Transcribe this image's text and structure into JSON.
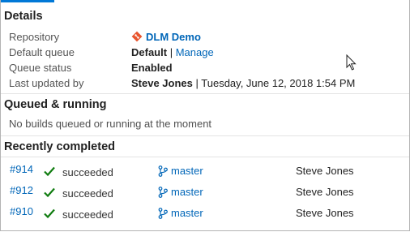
{
  "details": {
    "title": "Details",
    "fields": [
      {
        "label": "Repository",
        "value": "DLM Demo"
      },
      {
        "label": "Default queue",
        "value": "Default",
        "separator": "|",
        "link": "Manage"
      },
      {
        "label": "Queue status",
        "value": "Enabled"
      },
      {
        "label": "Last updated by",
        "value": "Steve Jones",
        "separator": "|",
        "extra": "Tuesday, June 12, 2018 1:54 PM"
      }
    ]
  },
  "queued": {
    "title": "Queued & running",
    "empty_message": "No builds queued or running at the moment"
  },
  "recent": {
    "title": "Recently completed",
    "builds": [
      {
        "id": "#914",
        "status": "succeeded",
        "branch": "master",
        "user": "Steve Jones"
      },
      {
        "id": "#912",
        "status": "succeeded",
        "branch": "master",
        "user": "Steve Jones"
      },
      {
        "id": "#910",
        "status": "succeeded",
        "branch": "master",
        "user": "Steve Jones"
      }
    ]
  },
  "colors": {
    "accent": "#0078d7",
    "link": "#0066b8",
    "success": "#107c10",
    "git": "#e8542d"
  },
  "icons": {
    "repo": "git-diamond-icon",
    "check": "checkmark-icon",
    "branch": "branch-icon",
    "cursor": "mouse-pointer-icon"
  }
}
